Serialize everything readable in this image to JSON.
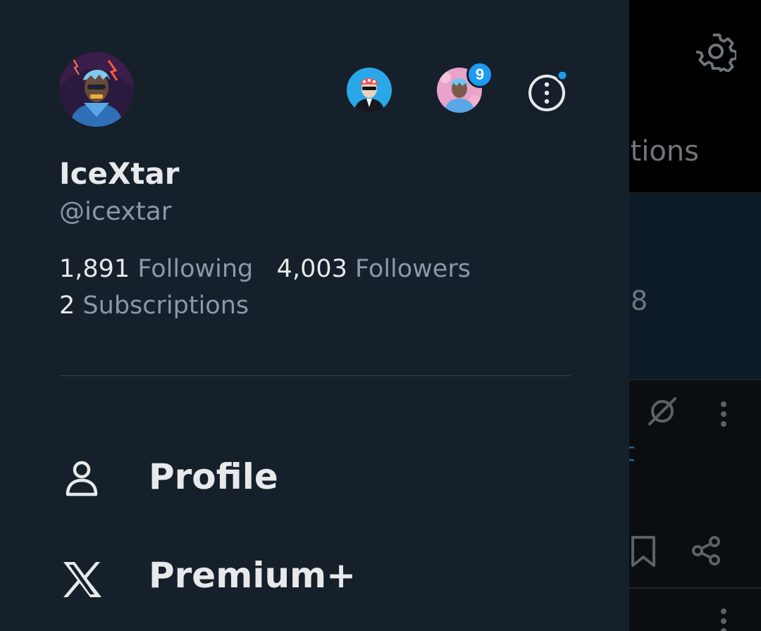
{
  "background": {
    "tab_partial": "tions",
    "count_partial": "8",
    "link_partial": "t"
  },
  "drawer": {
    "user": {
      "display_name": "IceXtar",
      "handle": "@icextar"
    },
    "account_switcher": {
      "notification_count": "9"
    },
    "stats": {
      "following_count": "1,891",
      "following_label": "Following",
      "followers_count": "4,003",
      "followers_label": "Followers",
      "subscriptions_count": "2",
      "subscriptions_label": "Subscriptions"
    },
    "menu": [
      {
        "label": "Profile",
        "icon": "person-icon"
      },
      {
        "label": "Premium+",
        "icon": "x-logo-icon"
      }
    ]
  },
  "colors": {
    "drawer_bg": "#15202b",
    "primary_text": "#e7e9ea",
    "secondary_text": "#8b98a5",
    "accent": "#1d9bf0",
    "divider": "#38444d"
  }
}
